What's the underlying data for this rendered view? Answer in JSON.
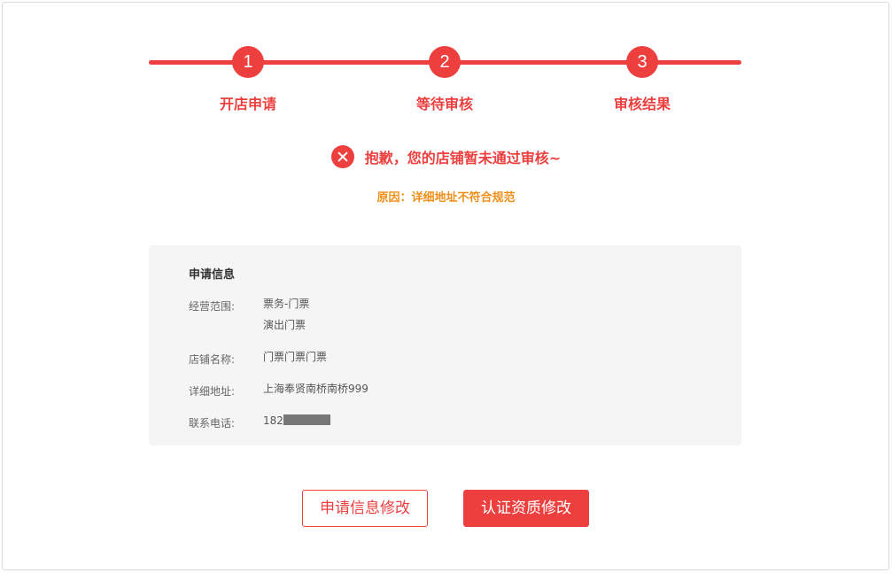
{
  "steps": [
    {
      "number": "1",
      "label": "开店申请"
    },
    {
      "number": "2",
      "label": "等待审核"
    },
    {
      "number": "3",
      "label": "审核结果"
    }
  ],
  "result": {
    "icon": "close-circle-icon",
    "message": "抱歉，您的店铺暂未通过审核~",
    "reason": "原因：详细地址不符合规范"
  },
  "application_info": {
    "title": "申请信息",
    "business_scope": {
      "label": "经营范围:",
      "values": [
        "票务-门票",
        "演出门票"
      ]
    },
    "shop_name": {
      "label": "店铺名称:",
      "value": "门票门票门票"
    },
    "address": {
      "label": "详细地址:",
      "value": "上海奉贤南桥南桥999"
    },
    "phone": {
      "label": "联系电话:",
      "value_prefix": "182"
    }
  },
  "buttons": {
    "edit_application": "申请信息修改",
    "edit_certification": "认证资质修改"
  },
  "colors": {
    "accent": "#ee3f3f",
    "warning": "#f0901a",
    "panel_bg": "#f5f5f5"
  }
}
